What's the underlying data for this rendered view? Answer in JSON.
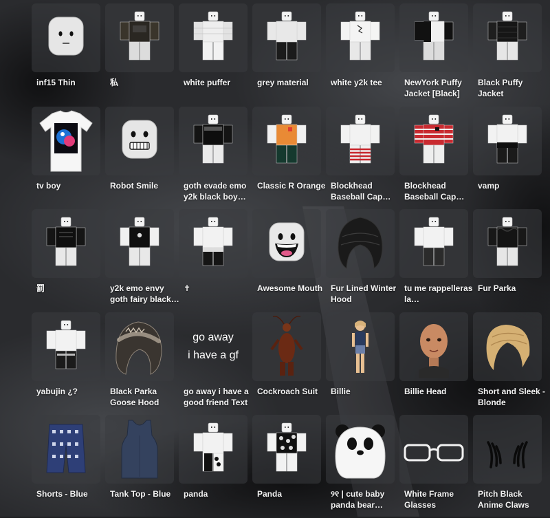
{
  "page": {
    "background": "#1f2022",
    "tile_color": "#3a3c40",
    "text_color": "#f3f3f3"
  },
  "items": [
    {
      "name": "inf15 Thin",
      "thumb": "face-neutral"
    },
    {
      "name": "私",
      "thumb": "avatar-dark-shirt"
    },
    {
      "name": "white puffer",
      "thumb": "avatar-white-puffer"
    },
    {
      "name": "grey material",
      "thumb": "avatar-grey-material"
    },
    {
      "name": "white y2k tee",
      "thumb": "avatar-white-tee"
    },
    {
      "name": "NewYork Puffy Jacket [Black]",
      "thumb": "avatar-black-white-jacket"
    },
    {
      "name": "Black Puffy Jacket",
      "thumb": "avatar-black-puffy"
    },
    {
      "name": "tv boy",
      "thumb": "tshirt-tv-boy"
    },
    {
      "name": "Robot Smile",
      "thumb": "face-robot-smile"
    },
    {
      "name": "goth evade emo y2k black boy…",
      "thumb": "avatar-goth-black"
    },
    {
      "name": "Classic R Orange",
      "thumb": "avatar-orange-shirt"
    },
    {
      "name": "Blockhead Baseball Cap…",
      "thumb": "avatar-red-striped"
    },
    {
      "name": "Blockhead Baseball Cap…",
      "thumb": "avatar-red-striped-2"
    },
    {
      "name": "vamp",
      "thumb": "avatar-vamp"
    },
    {
      "name": "罰",
      "thumb": "avatar-black-tee"
    },
    {
      "name": "y2k emo envy goth fairy black…",
      "thumb": "avatar-black-tee-skull"
    },
    {
      "name": "✝",
      "thumb": "avatar-white-cross"
    },
    {
      "name": "Awesome Mouth",
      "thumb": "face-awesome"
    },
    {
      "name": "Fur Lined Winter Hood",
      "thumb": "hood-black"
    },
    {
      "name": "tu me rappelleras la…",
      "thumb": "avatar-white-dark-pants"
    },
    {
      "name": "Fur Parka",
      "thumb": "avatar-fur-parka"
    },
    {
      "name": "yabujin ¿?",
      "thumb": "avatar-yabujin"
    },
    {
      "name": "Black Parka Goose Hood",
      "thumb": "hood-fur-parka"
    },
    {
      "name": "go away i have a good friend Text",
      "thumb": "text-go-away",
      "thumb_lines": [
        "go away",
        "i have a gf"
      ]
    },
    {
      "name": "Cockroach Suit",
      "thumb": "cockroach-suit"
    },
    {
      "name": "Billie",
      "thumb": "figure-billie"
    },
    {
      "name": "Billie Head",
      "thumb": "head-billie"
    },
    {
      "name": "Short and Sleek - Blonde",
      "thumb": "hair-blonde"
    },
    {
      "name": "Shorts - Blue",
      "thumb": "shorts-blue"
    },
    {
      "name": "Tank Top - Blue",
      "thumb": "tanktop-blue"
    },
    {
      "name": "panda",
      "thumb": "avatar-panda"
    },
    {
      "name": "Panda",
      "thumb": "avatar-panda-black"
    },
    {
      "name": "୨୧ | cute baby panda bear…",
      "thumb": "hat-panda"
    },
    {
      "name": "White Frame Glasses",
      "thumb": "glasses-white"
    },
    {
      "name": "Pitch Black Anime Claws",
      "thumb": "claws-black"
    }
  ]
}
